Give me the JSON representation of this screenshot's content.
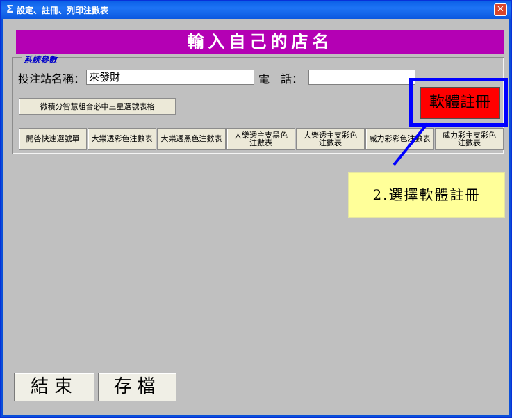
{
  "window": {
    "title": "設定、註冊、列印注數表",
    "icon": "sigma-icon",
    "close_label": "✕"
  },
  "banner": {
    "text": "輸入自己的店名",
    "color": "#b400b4"
  },
  "system_params": {
    "group_title": "系統參數",
    "station_name_label": "投注站名稱：",
    "station_name_value": "來發財",
    "phone_label": "電　話：",
    "phone_value": ""
  },
  "buttons": {
    "micro_calc": "微積分智慧組合必中三星選號表格",
    "open_quick": "開啓快速選號單",
    "lotto_color": "大樂透彩色注數表",
    "lotto_black": "大樂透黑色注數表",
    "lotto_main_black": "大樂透主支黑色注數表",
    "lotto_main_color": "大樂透主支彩色注數表",
    "power_color": "威力彩彩色注數表",
    "power_main_color": "威力彩主支彩色注數表",
    "register": "軟體註冊",
    "exit": "結束",
    "save": "存檔"
  },
  "annotation": {
    "callout_text": "2.選擇軟體註冊",
    "highlight_color": "#0000ff",
    "callout_bg": "#ffff99"
  },
  "colors": {
    "titlebar": "#0a5fe6",
    "client_bg": "#c0c0c0",
    "register_bg": "#ff0000"
  }
}
